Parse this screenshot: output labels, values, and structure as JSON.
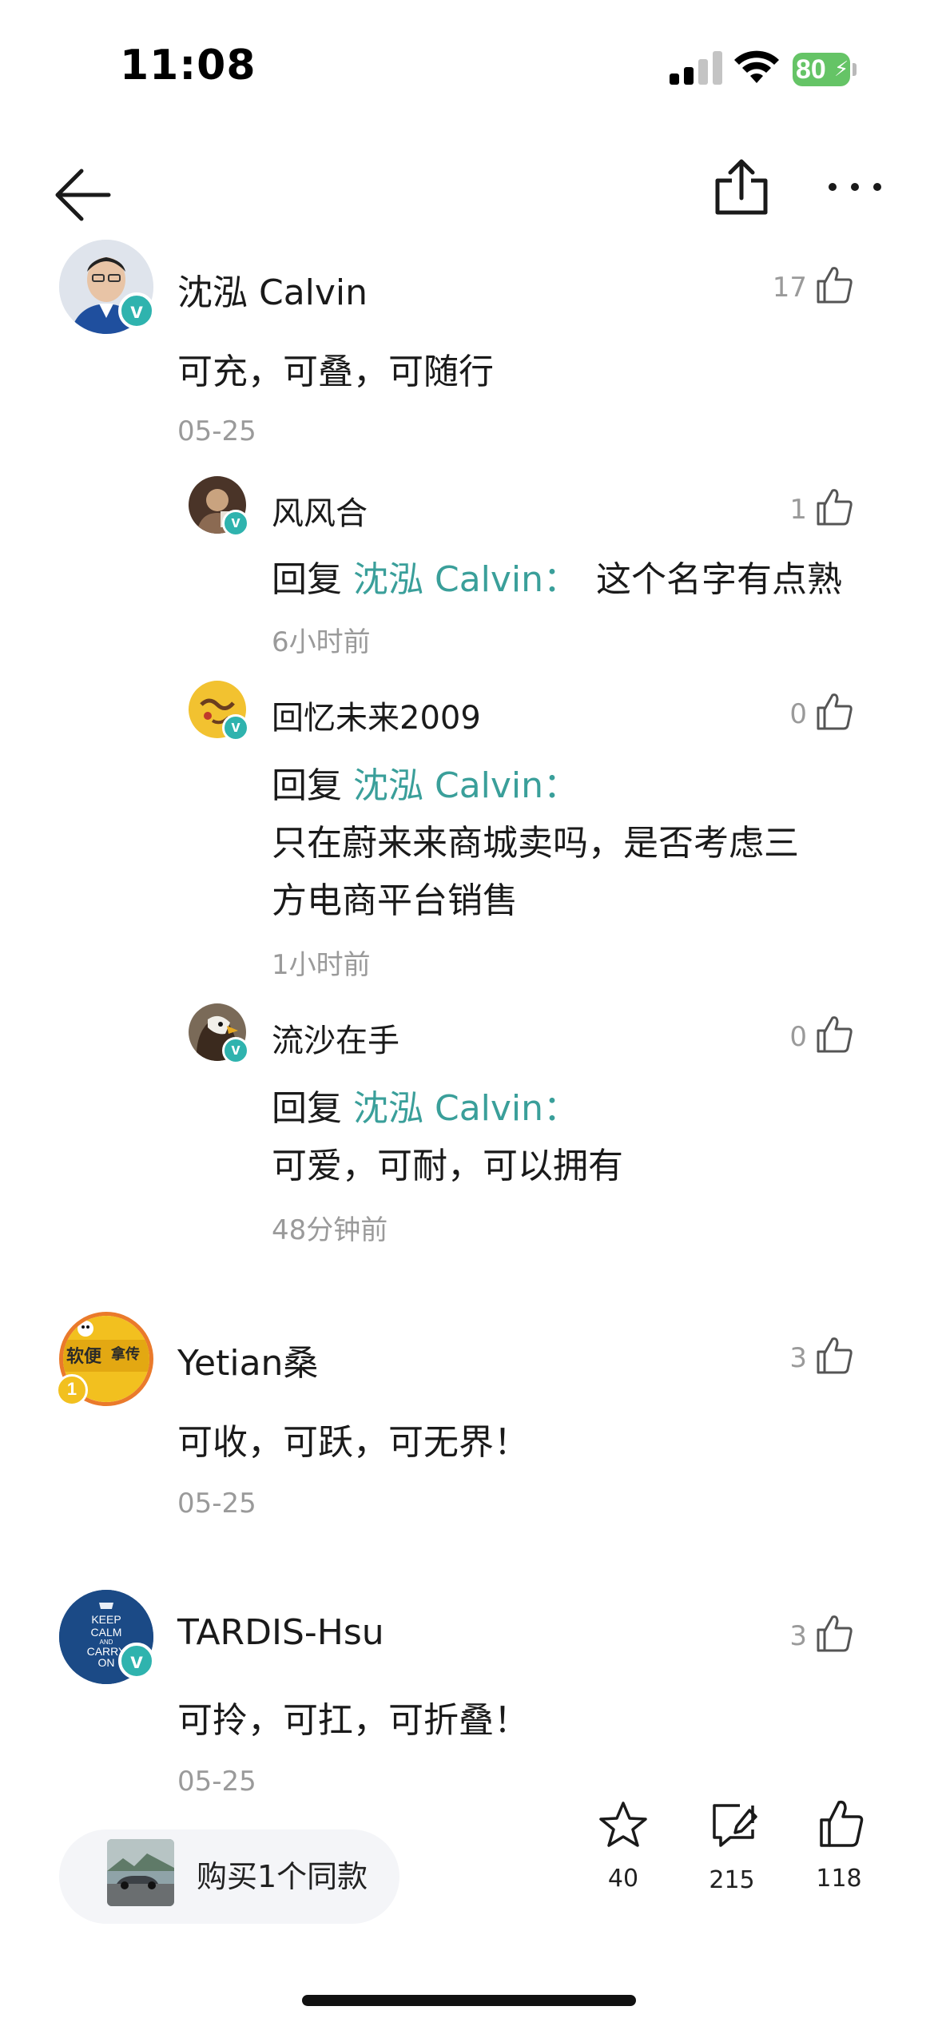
{
  "status_bar": {
    "time": "11:08",
    "battery": "80"
  },
  "colors": {
    "accent_teal": "#3a9f9a",
    "badge_teal": "#2fb3ae",
    "battery_green": "#65c466",
    "muted_gray": "#9a9a9a"
  },
  "nav": {
    "back_icon": "arrow-left-icon",
    "share_icon": "share-icon",
    "more_icon": "more-dots-icon"
  },
  "comments": [
    {
      "author": "沈泓 Calvin",
      "text": "可充，可叠，可随行",
      "date": "05-25",
      "likes": "17",
      "replies": [
        {
          "author": "风风合",
          "reply_prefix": "回复",
          "reply_to": "沈泓 Calvin：",
          "text": "这个名字有点熟",
          "time": "6小时前",
          "likes": "1"
        },
        {
          "author": "回忆未来2009",
          "reply_prefix": "回复",
          "reply_to": "沈泓 Calvin：",
          "text_line1": "只在蔚来来商城卖吗，是否考虑三",
          "text_line2": "方电商平台销售",
          "time": "1小时前",
          "likes": "0"
        },
        {
          "author": "流沙在手",
          "reply_prefix": "回复",
          "reply_to": "沈泓 Calvin：",
          "text": "可爱，可耐，可以拥有",
          "time": "48分钟前",
          "likes": "0"
        }
      ]
    },
    {
      "author": "Yetian桑",
      "text": "可收，可跃，可无界！",
      "date": "05-25",
      "likes": "3",
      "avatar_text_left": "软便",
      "avatar_text_right": "拿传",
      "avatar_level": "1"
    },
    {
      "author": "TARDIS-Hsu",
      "text": "可拎，可扛，可折叠！",
      "date": "05-25",
      "likes": "3",
      "avatar_text": [
        "KEEP",
        "CALM",
        "AND",
        "CARRY",
        "ON"
      ]
    }
  ],
  "bottom_bar": {
    "buy_label": "购买1个同款",
    "favorites": "40",
    "comments": "215",
    "likes": "118"
  }
}
